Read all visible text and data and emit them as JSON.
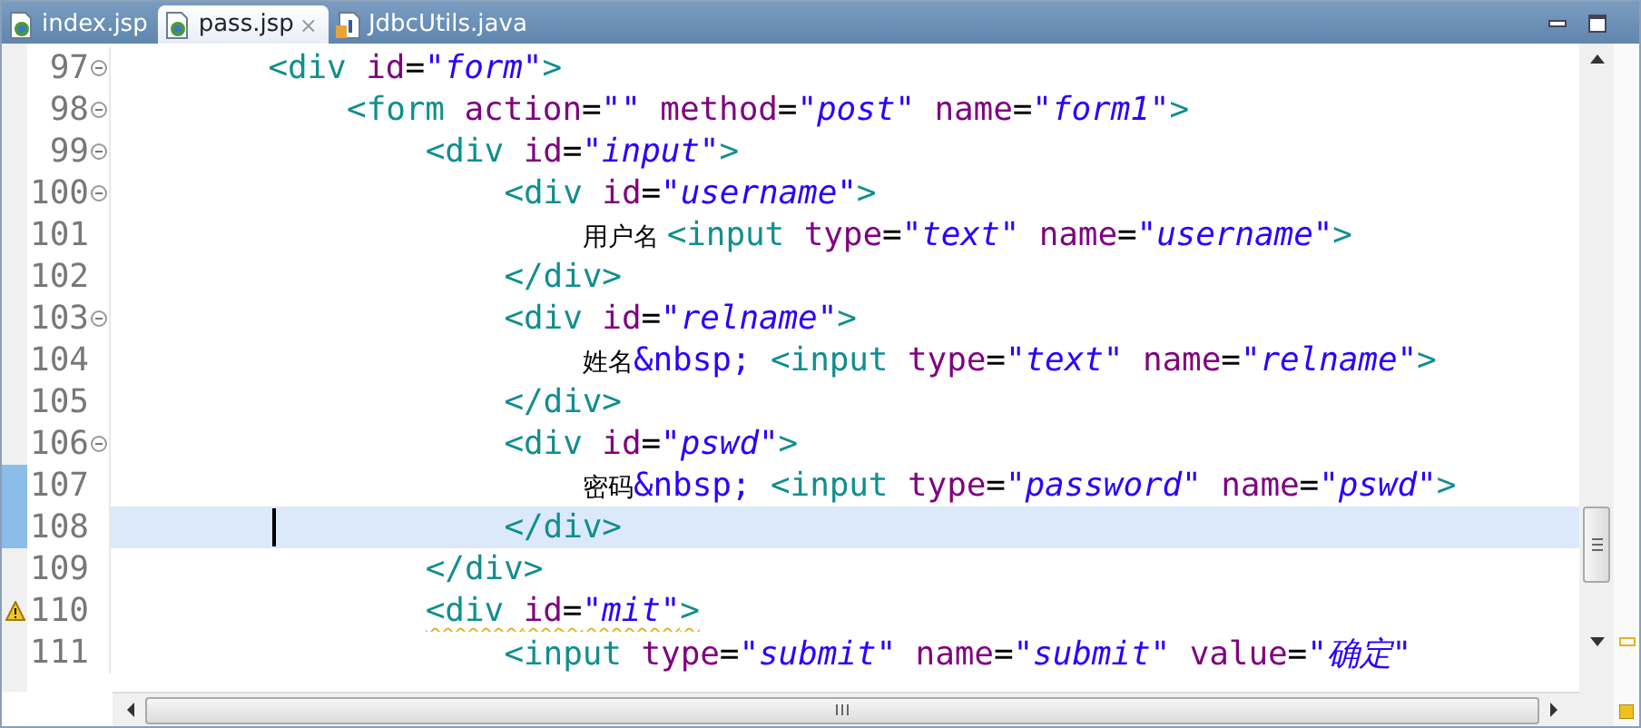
{
  "tabs": [
    {
      "label": "index.jsp",
      "selected": false,
      "kind": "jsp"
    },
    {
      "label": "pass.jsp",
      "selected": true,
      "kind": "jsp",
      "close": "×"
    },
    {
      "label": "JdbcUtils.java",
      "selected": false,
      "kind": "java"
    }
  ],
  "editor": {
    "lines": [
      {
        "number": "97",
        "fold": true,
        "changed": false,
        "current": false,
        "warning": false,
        "tokens": [
          {
            "kind": "tag",
            "text": "<div "
          },
          {
            "kind": "attr",
            "text": "id"
          },
          {
            "kind": "eq",
            "text": "="
          },
          {
            "kind": "str",
            "text": "\"form\""
          },
          {
            "kind": "tag",
            "text": ">"
          }
        ],
        "children": [
          {
            "number": "98",
            "fold": true,
            "changed": false,
            "current": false,
            "warning": false,
            "tokens": [
              {
                "kind": "tag",
                "text": "<form "
              },
              {
                "kind": "attr",
                "text": "action"
              },
              {
                "kind": "eq",
                "text": "="
              },
              {
                "kind": "str",
                "text": "\"\" "
              },
              {
                "kind": "attr",
                "text": "method"
              },
              {
                "kind": "eq",
                "text": "="
              },
              {
                "kind": "str",
                "text": "\"post\" "
              },
              {
                "kind": "attr",
                "text": "name"
              },
              {
                "kind": "eq",
                "text": "="
              },
              {
                "kind": "str",
                "text": "\"form1\""
              },
              {
                "kind": "tag",
                "text": ">"
              }
            ],
            "children": [
              {
                "number": "99",
                "fold": true,
                "changed": false,
                "current": false,
                "warning": false,
                "tokens": [
                  {
                    "kind": "tag",
                    "text": "<div "
                  },
                  {
                    "kind": "attr",
                    "text": "id"
                  },
                  {
                    "kind": "eq",
                    "text": "="
                  },
                  {
                    "kind": "str",
                    "text": "\"input\""
                  },
                  {
                    "kind": "tag",
                    "text": ">"
                  }
                ],
                "children": [
                  {
                    "number": "100",
                    "fold": true,
                    "changed": false,
                    "current": false,
                    "warning": false,
                    "tokens": [
                      {
                        "kind": "tag",
                        "text": "<div "
                      },
                      {
                        "kind": "attr",
                        "text": "id"
                      },
                      {
                        "kind": "eq",
                        "text": "="
                      },
                      {
                        "kind": "str",
                        "text": "\"username\""
                      },
                      {
                        "kind": "tag",
                        "text": ">"
                      }
                    ],
                    "children": [
                      {
                        "number": "101",
                        "fold": false,
                        "changed": false,
                        "current": false,
                        "warning": false,
                        "tokens": [
                          {
                            "kind": "cjk",
                            "text": "用户名 "
                          },
                          {
                            "kind": "tag",
                            "text": "<input "
                          },
                          {
                            "kind": "attr",
                            "text": "type"
                          },
                          {
                            "kind": "eq",
                            "text": "="
                          },
                          {
                            "kind": "str",
                            "text": "\"text\" "
                          },
                          {
                            "kind": "attr",
                            "text": "name"
                          },
                          {
                            "kind": "eq",
                            "text": "="
                          },
                          {
                            "kind": "str",
                            "text": "\"username\""
                          },
                          {
                            "kind": "tag",
                            "text": ">"
                          }
                        ]
                      }
                    ]
                  },
                  {
                    "number": "102",
                    "fold": false,
                    "changed": false,
                    "current": false,
                    "warning": false,
                    "tokens": [
                      {
                        "kind": "tag",
                        "text": "</div>"
                      }
                    ]
                  },
                  {
                    "number": "103",
                    "fold": true,
                    "changed": false,
                    "current": false,
                    "warning": false,
                    "tokens": [
                      {
                        "kind": "tag",
                        "text": "<div "
                      },
                      {
                        "kind": "attr",
                        "text": "id"
                      },
                      {
                        "kind": "eq",
                        "text": "="
                      },
                      {
                        "kind": "str",
                        "text": "\"relname\""
                      },
                      {
                        "kind": "tag",
                        "text": ">"
                      }
                    ],
                    "children": [
                      {
                        "number": "104",
                        "fold": false,
                        "changed": false,
                        "current": false,
                        "warning": false,
                        "tokens": [
                          {
                            "kind": "cjk",
                            "text": "姓名"
                          },
                          {
                            "kind": "entity",
                            "text": "&nbsp; "
                          },
                          {
                            "kind": "tag",
                            "text": "<input "
                          },
                          {
                            "kind": "attr",
                            "text": "type"
                          },
                          {
                            "kind": "eq",
                            "text": "="
                          },
                          {
                            "kind": "str",
                            "text": "\"text\" "
                          },
                          {
                            "kind": "attr",
                            "text": "name"
                          },
                          {
                            "kind": "eq",
                            "text": "="
                          },
                          {
                            "kind": "str",
                            "text": "\"relname\""
                          },
                          {
                            "kind": "tag",
                            "text": ">"
                          }
                        ]
                      }
                    ]
                  },
                  {
                    "number": "105",
                    "fold": false,
                    "changed": false,
                    "current": false,
                    "warning": false,
                    "tokens": [
                      {
                        "kind": "tag",
                        "text": "</div>"
                      }
                    ]
                  },
                  {
                    "number": "106",
                    "fold": true,
                    "changed": false,
                    "current": false,
                    "warning": false,
                    "tokens": [
                      {
                        "kind": "tag",
                        "text": "<div "
                      },
                      {
                        "kind": "attr",
                        "text": "id"
                      },
                      {
                        "kind": "eq",
                        "text": "="
                      },
                      {
                        "kind": "str",
                        "text": "\"pswd\""
                      },
                      {
                        "kind": "tag",
                        "text": ">"
                      }
                    ],
                    "children": [
                      {
                        "number": "107",
                        "fold": false,
                        "changed": true,
                        "current": false,
                        "warning": false,
                        "tokens": [
                          {
                            "kind": "cjk",
                            "text": "密码"
                          },
                          {
                            "kind": "entity",
                            "text": "&nbsp; "
                          },
                          {
                            "kind": "tag",
                            "text": "<input "
                          },
                          {
                            "kind": "attr",
                            "text": "type"
                          },
                          {
                            "kind": "eq",
                            "text": "="
                          },
                          {
                            "kind": "str",
                            "text": "\"password\" "
                          },
                          {
                            "kind": "attr",
                            "text": "name"
                          },
                          {
                            "kind": "eq",
                            "text": "="
                          },
                          {
                            "kind": "str",
                            "text": "\"pswd\""
                          },
                          {
                            "kind": "tag",
                            "text": ">"
                          }
                        ]
                      }
                    ]
                  },
                  {
                    "number": "108",
                    "fold": false,
                    "changed": true,
                    "current": true,
                    "warning": false,
                    "tokens": [
                      {
                        "kind": "tag",
                        "text": "</div>"
                      }
                    ]
                  }
                ]
              },
              {
                "number": "109",
                "fold": false,
                "changed": false,
                "current": false,
                "warning": false,
                "tokens": [
                  {
                    "kind": "tag",
                    "text": "</div>"
                  }
                ]
              },
              {
                "number": "110",
                "fold": false,
                "changed": false,
                "current": false,
                "warning": true,
                "tokens": [
                  {
                    "kind": "tag",
                    "text": "<div "
                  },
                  {
                    "kind": "attr",
                    "text": "id"
                  },
                  {
                    "kind": "eq",
                    "text": "="
                  },
                  {
                    "kind": "str",
                    "text": "\"mit\""
                  },
                  {
                    "kind": "tag",
                    "text": ">"
                  }
                ],
                "children": [
                  {
                    "number": "111",
                    "fold": false,
                    "changed": false,
                    "current": false,
                    "warning": false,
                    "tokens": [
                      {
                        "kind": "tag",
                        "text": "<input "
                      },
                      {
                        "kind": "attr",
                        "text": "type"
                      },
                      {
                        "kind": "eq",
                        "text": "="
                      },
                      {
                        "kind": "str",
                        "text": "\"submit\" "
                      },
                      {
                        "kind": "attr",
                        "text": "name"
                      },
                      {
                        "kind": "eq",
                        "text": "="
                      },
                      {
                        "kind": "str",
                        "text": "\"submit\" "
                      },
                      {
                        "kind": "attr",
                        "text": "value"
                      },
                      {
                        "kind": "eq",
                        "text": "="
                      },
                      {
                        "kind": "str",
                        "text": "\"确定\""
                      }
                    ]
                  }
                ]
              }
            ]
          }
        ]
      }
    ]
  }
}
